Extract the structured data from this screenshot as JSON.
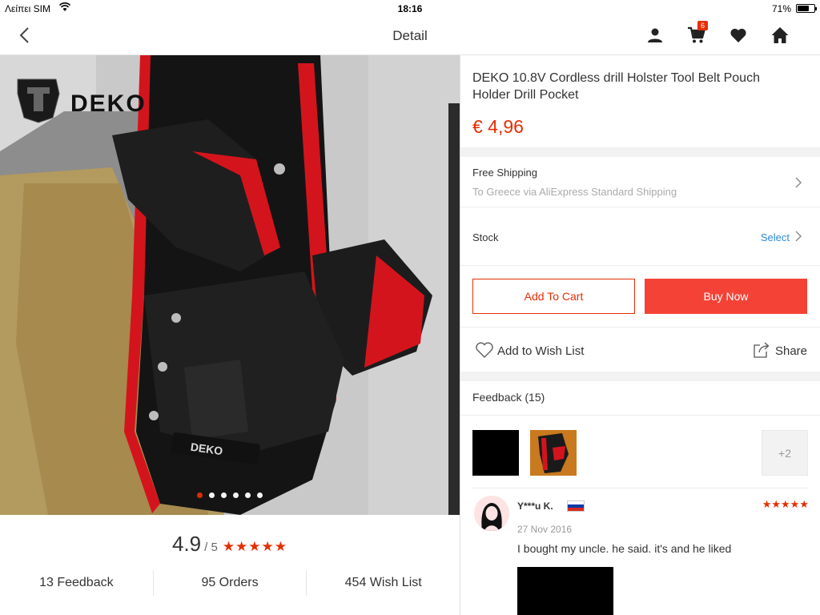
{
  "status_bar": {
    "carrier": "Λείπει SIM",
    "time": "18:16",
    "battery_percent": "71%",
    "battery_level": 0.71
  },
  "nav": {
    "title": "Detail",
    "cart_count": "6",
    "icons": [
      "back-chevron-icon",
      "user-icon",
      "cart-icon",
      "heart-icon",
      "home-icon"
    ]
  },
  "gallery": {
    "image_count": 6,
    "active_index": 0,
    "brand_text": "DEKO"
  },
  "rating": {
    "score": "4.9",
    "out_of": "/ 5",
    "stars": "★★★★★"
  },
  "stats": {
    "feedback": "13 Feedback",
    "orders": "95 Orders",
    "wishlist": "454 Wish List"
  },
  "product": {
    "title": "DEKO 10.8V Cordless drill Holster Tool Belt Pouch Holder Drill Pocket",
    "price": "€ 4,96"
  },
  "shipping": {
    "label": "Free Shipping",
    "detail": "To Greece via AliExpress Standard Shipping"
  },
  "stock": {
    "label": "Stock",
    "action": "Select"
  },
  "actions": {
    "add_to_cart": "Add To Cart",
    "buy_now": "Buy Now",
    "wish": "Add to Wish List",
    "share": "Share"
  },
  "feedback": {
    "header": "Feedback (15)",
    "more_images": "+2",
    "review": {
      "reviewer": "Y***u K.",
      "country_flag": "russia-flag",
      "stars": "★★★★★",
      "date": "27 Nov 2016",
      "text": "I bought my uncle. he said. it's and he liked"
    }
  },
  "colors": {
    "accent": "#e62e04",
    "buy_button": "#f44336",
    "link": "#2d8ad8"
  }
}
